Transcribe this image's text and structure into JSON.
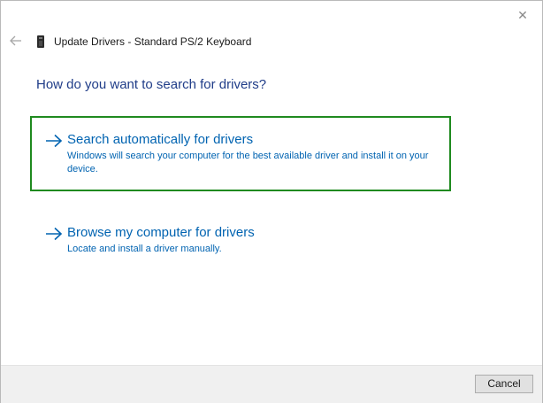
{
  "window": {
    "title": "Update Drivers - Standard PS/2 Keyboard",
    "close_glyph": "✕"
  },
  "heading": "How do you want to search for drivers?",
  "options": [
    {
      "title": "Search automatically for drivers",
      "description": "Windows will search your computer for the best available driver and install it on your device.",
      "selected": true,
      "icon": "arrow-right-icon"
    },
    {
      "title": "Browse my computer for drivers",
      "description": "Locate and install a driver manually.",
      "selected": false,
      "icon": "arrow-right-icon"
    }
  ],
  "footer": {
    "cancel_label": "Cancel"
  },
  "colors": {
    "accent": "#0063b1",
    "heading": "#1f3c88",
    "selection_border": "#1f8a1f"
  }
}
